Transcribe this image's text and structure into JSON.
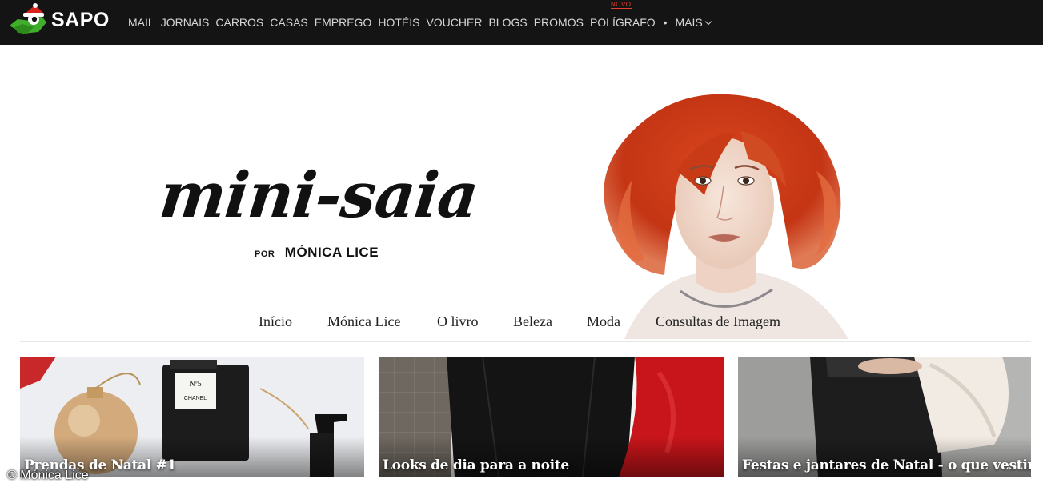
{
  "topbar": {
    "logo_text": "SAPO",
    "logo_icon": "sapo-frog-santa-hat-icon",
    "nav_items": [
      "MAIL",
      "JORNAIS",
      "CARROS",
      "CASAS",
      "EMPREGO",
      "HOTÉIS",
      "VOUCHER",
      "BLOGS",
      "PROMOS",
      "POLÍGRAFO"
    ],
    "new_badge": "NOVO",
    "more_label": "MAIS",
    "separator": "•"
  },
  "header": {
    "blog_title": "mini-saia",
    "byline_prefix": "POR",
    "byline_author": "MÓNICA LICE",
    "portrait_icon": "red-haired-woman-illustration"
  },
  "menu": {
    "items": [
      "Início",
      "Mónica Lice",
      "O livro",
      "Beleza",
      "Moda",
      "Consultas de Imagem"
    ]
  },
  "posts": [
    {
      "title": "Prendas de Natal #1"
    },
    {
      "title": "Looks de dia para a noite"
    },
    {
      "title": "Festas e jantares de Natal - o que vestir?"
    }
  ],
  "copyright": "© Mónica Lice",
  "colors": {
    "topbar_bg": "#141414",
    "badge": "#e4402f",
    "logo_green": "#3fae2a"
  }
}
